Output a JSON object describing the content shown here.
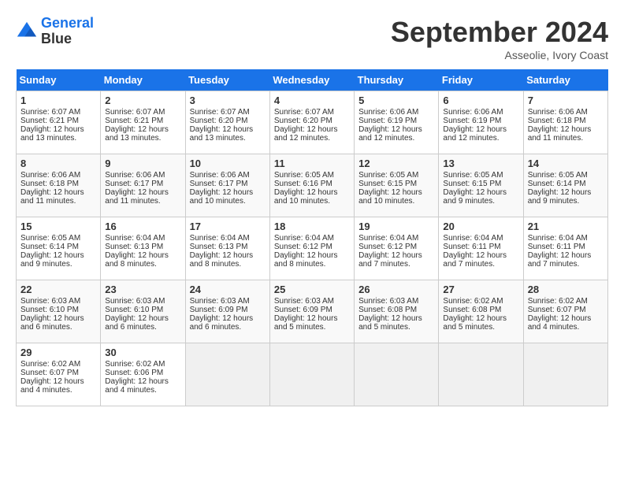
{
  "header": {
    "logo_line1": "General",
    "logo_line2": "Blue",
    "month": "September 2024",
    "location": "Asseolie, Ivory Coast"
  },
  "days_of_week": [
    "Sunday",
    "Monday",
    "Tuesday",
    "Wednesday",
    "Thursday",
    "Friday",
    "Saturday"
  ],
  "weeks": [
    [
      {
        "day": "1",
        "lines": [
          "Sunrise: 6:07 AM",
          "Sunset: 6:21 PM",
          "Daylight: 12 hours",
          "and 13 minutes."
        ]
      },
      {
        "day": "2",
        "lines": [
          "Sunrise: 6:07 AM",
          "Sunset: 6:21 PM",
          "Daylight: 12 hours",
          "and 13 minutes."
        ]
      },
      {
        "day": "3",
        "lines": [
          "Sunrise: 6:07 AM",
          "Sunset: 6:20 PM",
          "Daylight: 12 hours",
          "and 13 minutes."
        ]
      },
      {
        "day": "4",
        "lines": [
          "Sunrise: 6:07 AM",
          "Sunset: 6:20 PM",
          "Daylight: 12 hours",
          "and 12 minutes."
        ]
      },
      {
        "day": "5",
        "lines": [
          "Sunrise: 6:06 AM",
          "Sunset: 6:19 PM",
          "Daylight: 12 hours",
          "and 12 minutes."
        ]
      },
      {
        "day": "6",
        "lines": [
          "Sunrise: 6:06 AM",
          "Sunset: 6:19 PM",
          "Daylight: 12 hours",
          "and 12 minutes."
        ]
      },
      {
        "day": "7",
        "lines": [
          "Sunrise: 6:06 AM",
          "Sunset: 6:18 PM",
          "Daylight: 12 hours",
          "and 11 minutes."
        ]
      }
    ],
    [
      {
        "day": "8",
        "lines": [
          "Sunrise: 6:06 AM",
          "Sunset: 6:18 PM",
          "Daylight: 12 hours",
          "and 11 minutes."
        ]
      },
      {
        "day": "9",
        "lines": [
          "Sunrise: 6:06 AM",
          "Sunset: 6:17 PM",
          "Daylight: 12 hours",
          "and 11 minutes."
        ]
      },
      {
        "day": "10",
        "lines": [
          "Sunrise: 6:06 AM",
          "Sunset: 6:17 PM",
          "Daylight: 12 hours",
          "and 10 minutes."
        ]
      },
      {
        "day": "11",
        "lines": [
          "Sunrise: 6:05 AM",
          "Sunset: 6:16 PM",
          "Daylight: 12 hours",
          "and 10 minutes."
        ]
      },
      {
        "day": "12",
        "lines": [
          "Sunrise: 6:05 AM",
          "Sunset: 6:15 PM",
          "Daylight: 12 hours",
          "and 10 minutes."
        ]
      },
      {
        "day": "13",
        "lines": [
          "Sunrise: 6:05 AM",
          "Sunset: 6:15 PM",
          "Daylight: 12 hours",
          "and 9 minutes."
        ]
      },
      {
        "day": "14",
        "lines": [
          "Sunrise: 6:05 AM",
          "Sunset: 6:14 PM",
          "Daylight: 12 hours",
          "and 9 minutes."
        ]
      }
    ],
    [
      {
        "day": "15",
        "lines": [
          "Sunrise: 6:05 AM",
          "Sunset: 6:14 PM",
          "Daylight: 12 hours",
          "and 9 minutes."
        ]
      },
      {
        "day": "16",
        "lines": [
          "Sunrise: 6:04 AM",
          "Sunset: 6:13 PM",
          "Daylight: 12 hours",
          "and 8 minutes."
        ]
      },
      {
        "day": "17",
        "lines": [
          "Sunrise: 6:04 AM",
          "Sunset: 6:13 PM",
          "Daylight: 12 hours",
          "and 8 minutes."
        ]
      },
      {
        "day": "18",
        "lines": [
          "Sunrise: 6:04 AM",
          "Sunset: 6:12 PM",
          "Daylight: 12 hours",
          "and 8 minutes."
        ]
      },
      {
        "day": "19",
        "lines": [
          "Sunrise: 6:04 AM",
          "Sunset: 6:12 PM",
          "Daylight: 12 hours",
          "and 7 minutes."
        ]
      },
      {
        "day": "20",
        "lines": [
          "Sunrise: 6:04 AM",
          "Sunset: 6:11 PM",
          "Daylight: 12 hours",
          "and 7 minutes."
        ]
      },
      {
        "day": "21",
        "lines": [
          "Sunrise: 6:04 AM",
          "Sunset: 6:11 PM",
          "Daylight: 12 hours",
          "and 7 minutes."
        ]
      }
    ],
    [
      {
        "day": "22",
        "lines": [
          "Sunrise: 6:03 AM",
          "Sunset: 6:10 PM",
          "Daylight: 12 hours",
          "and 6 minutes."
        ]
      },
      {
        "day": "23",
        "lines": [
          "Sunrise: 6:03 AM",
          "Sunset: 6:10 PM",
          "Daylight: 12 hours",
          "and 6 minutes."
        ]
      },
      {
        "day": "24",
        "lines": [
          "Sunrise: 6:03 AM",
          "Sunset: 6:09 PM",
          "Daylight: 12 hours",
          "and 6 minutes."
        ]
      },
      {
        "day": "25",
        "lines": [
          "Sunrise: 6:03 AM",
          "Sunset: 6:09 PM",
          "Daylight: 12 hours",
          "and 5 minutes."
        ]
      },
      {
        "day": "26",
        "lines": [
          "Sunrise: 6:03 AM",
          "Sunset: 6:08 PM",
          "Daylight: 12 hours",
          "and 5 minutes."
        ]
      },
      {
        "day": "27",
        "lines": [
          "Sunrise: 6:02 AM",
          "Sunset: 6:08 PM",
          "Daylight: 12 hours",
          "and 5 minutes."
        ]
      },
      {
        "day": "28",
        "lines": [
          "Sunrise: 6:02 AM",
          "Sunset: 6:07 PM",
          "Daylight: 12 hours",
          "and 4 minutes."
        ]
      }
    ],
    [
      {
        "day": "29",
        "lines": [
          "Sunrise: 6:02 AM",
          "Sunset: 6:07 PM",
          "Daylight: 12 hours",
          "and 4 minutes."
        ]
      },
      {
        "day": "30",
        "lines": [
          "Sunrise: 6:02 AM",
          "Sunset: 6:06 PM",
          "Daylight: 12 hours",
          "and 4 minutes."
        ]
      },
      {
        "day": "",
        "lines": []
      },
      {
        "day": "",
        "lines": []
      },
      {
        "day": "",
        "lines": []
      },
      {
        "day": "",
        "lines": []
      },
      {
        "day": "",
        "lines": []
      }
    ]
  ]
}
